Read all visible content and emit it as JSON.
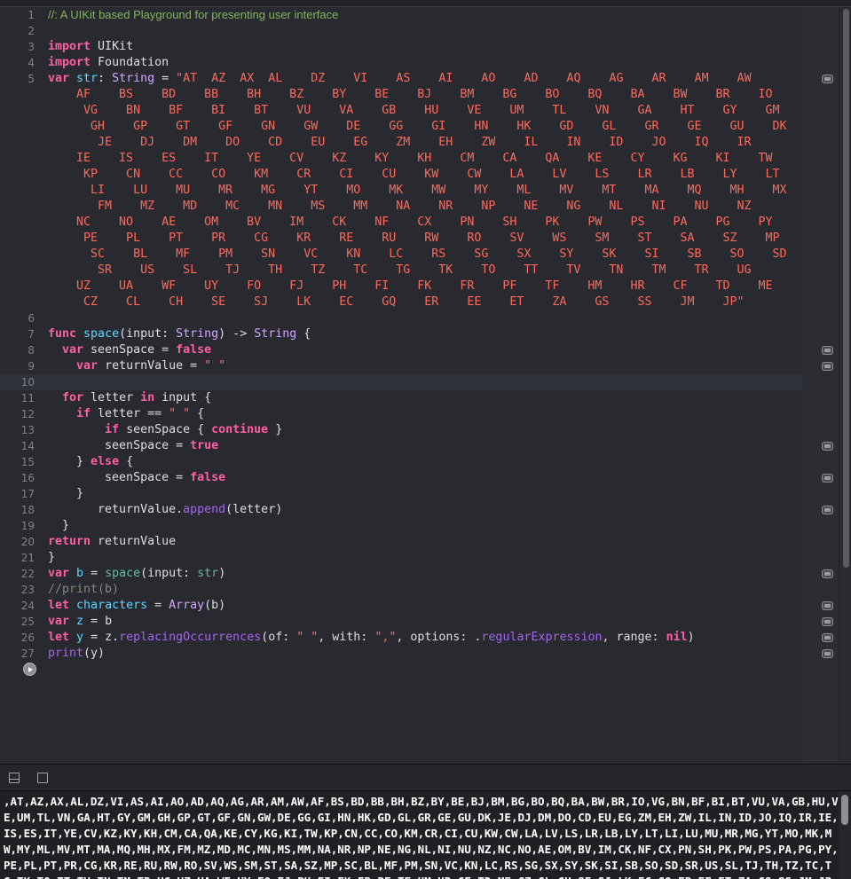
{
  "editor": {
    "current_line": 10,
    "result_lines": [
      5,
      8,
      9,
      14,
      16,
      18,
      22,
      24,
      25,
      26,
      27
    ],
    "lines": [
      {
        "n": 1,
        "tokens": [
          [
            "doc",
            "//: A UIKit based Playground for presenting user interface"
          ]
        ]
      },
      {
        "n": 2,
        "tokens": []
      },
      {
        "n": 3,
        "tokens": [
          [
            "k",
            "import"
          ],
          [
            "p",
            " UIKit"
          ]
        ]
      },
      {
        "n": 4,
        "tokens": [
          [
            "k",
            "import"
          ],
          [
            "p",
            " Foundation"
          ]
        ]
      },
      {
        "n": 5,
        "tokens": [
          [
            "k",
            "var"
          ],
          [
            "p",
            " "
          ],
          [
            "v",
            "str"
          ],
          [
            "p",
            ": "
          ],
          [
            "t",
            "String"
          ],
          [
            "p",
            " = "
          ],
          [
            "s",
            "\"AT  AZ  AX  AL    DZ    VI    AS    AI    AO    AD    AQ    AG    AR    AM    AW"
          ]
        ],
        "wrap": [
          "    AF    BS    BD    BB    BH    BZ    BY    BE    BJ    BM    BG    BO    BQ    BA    BW    BR    IO",
          "     VG    BN    BF    BI    BT    VU    VA    GB    HU    VE    UM    TL    VN    GA    HT    GY    GM",
          "      GH    GP    GT    GF    GN    GW    DE    GG    GI    HN    HK    GD    GL    GR    GE    GU    DK",
          "       JE    DJ    DM    DO    CD    EU    EG    ZM    EH    ZW    IL    IN    ID    JO    IQ    IR",
          "    IE    IS    ES    IT    YE    CV    KZ    KY    KH    CM    CA    QA    KE    CY    KG    KI    TW",
          "     KP    CN    CC    CO    KM    CR    CI    CU    KW    CW    LA    LV    LS    LR    LB    LY    LT",
          "      LI    LU    MU    MR    MG    YT    MO    MK    MW    MY    ML    MV    MT    MA    MQ    MH    MX",
          "       FM    MZ    MD    MC    MN    MS    MM    NA    NR    NP    NE    NG    NL    NI    NU    NZ",
          "    NC    NO    AE    OM    BV    IM    CK    NF    CX    PN    SH    PK    PW    PS    PA    PG    PY",
          "     PE    PL    PT    PR    CG    KR    RE    RU    RW    RO    SV    WS    SM    ST    SA    SZ    MP",
          "      SC    BL    MF    PM    SN    VC    KN    LC    RS    SG    SX    SY    SK    SI    SB    SO    SD",
          "       SR    US    SL    TJ    TH    TZ    TC    TG    TK    TO    TT    TV    TN    TM    TR    UG",
          "    UZ    UA    WF    UY    FO    FJ    PH    FI    FK    FR    PF    TF    HM    HR    CF    TD    ME",
          "     CZ    CL    CH    SE    SJ    LK    EC    GQ    ER    EE    ET    ZA    GS    SS    JM    JP\""
        ]
      },
      {
        "n": 6,
        "tokens": []
      },
      {
        "n": 7,
        "tokens": [
          [
            "k",
            "func"
          ],
          [
            "p",
            " "
          ],
          [
            "v",
            "space"
          ],
          [
            "p",
            "(input: "
          ],
          [
            "t",
            "String"
          ],
          [
            "p",
            ") -> "
          ],
          [
            "t",
            "String"
          ],
          [
            "p",
            " {"
          ]
        ]
      },
      {
        "n": 8,
        "tokens": [
          [
            "p",
            "  "
          ],
          [
            "k",
            "var"
          ],
          [
            "p",
            " seenSpace = "
          ],
          [
            "k",
            "false"
          ]
        ]
      },
      {
        "n": 9,
        "tokens": [
          [
            "p",
            "    "
          ],
          [
            "k",
            "var"
          ],
          [
            "p",
            " returnValue = "
          ],
          [
            "s",
            "\" \""
          ]
        ]
      },
      {
        "n": 10,
        "tokens": []
      },
      {
        "n": 11,
        "tokens": [
          [
            "p",
            "  "
          ],
          [
            "k",
            "for"
          ],
          [
            "p",
            " letter "
          ],
          [
            "k",
            "in"
          ],
          [
            "p",
            " input {"
          ]
        ]
      },
      {
        "n": 12,
        "tokens": [
          [
            "p",
            "    "
          ],
          [
            "k",
            "if"
          ],
          [
            "p",
            " letter == "
          ],
          [
            "s",
            "\" \""
          ],
          [
            "p",
            " {"
          ]
        ]
      },
      {
        "n": 13,
        "tokens": [
          [
            "p",
            "        "
          ],
          [
            "k",
            "if"
          ],
          [
            "p",
            " seenSpace { "
          ],
          [
            "k",
            "continue"
          ],
          [
            "p",
            " }"
          ]
        ]
      },
      {
        "n": 14,
        "tokens": [
          [
            "p",
            "        seenSpace = "
          ],
          [
            "k",
            "true"
          ]
        ]
      },
      {
        "n": 15,
        "tokens": [
          [
            "p",
            "    } "
          ],
          [
            "k",
            "else"
          ],
          [
            "p",
            " {"
          ]
        ]
      },
      {
        "n": 16,
        "tokens": [
          [
            "p",
            "        seenSpace = "
          ],
          [
            "k",
            "false"
          ]
        ]
      },
      {
        "n": 17,
        "tokens": [
          [
            "p",
            "    }"
          ]
        ]
      },
      {
        "n": 18,
        "tokens": [
          [
            "p",
            "       returnValue."
          ],
          [
            "f",
            "append"
          ],
          [
            "p",
            "(letter)"
          ]
        ]
      },
      {
        "n": 19,
        "tokens": [
          [
            "p",
            "  }"
          ]
        ]
      },
      {
        "n": 20,
        "tokens": [
          [
            "k",
            "return"
          ],
          [
            "p",
            " returnValue"
          ]
        ]
      },
      {
        "n": 21,
        "tokens": [
          [
            "p",
            "}"
          ]
        ]
      },
      {
        "n": 22,
        "tokens": [
          [
            "k",
            "var"
          ],
          [
            "p",
            " "
          ],
          [
            "v",
            "b"
          ],
          [
            "p",
            " = "
          ],
          [
            "u",
            "space"
          ],
          [
            "p",
            "(input: "
          ],
          [
            "u",
            "str"
          ],
          [
            "p",
            ")"
          ]
        ]
      },
      {
        "n": 23,
        "tokens": [
          [
            "c",
            "//print(b)"
          ]
        ]
      },
      {
        "n": 24,
        "tokens": [
          [
            "k",
            "let"
          ],
          [
            "p",
            " "
          ],
          [
            "v",
            "characters"
          ],
          [
            "p",
            " = "
          ],
          [
            "t",
            "Array"
          ],
          [
            "p",
            "(b)"
          ]
        ]
      },
      {
        "n": 25,
        "tokens": [
          [
            "k",
            "var"
          ],
          [
            "p",
            " "
          ],
          [
            "v",
            "z"
          ],
          [
            "p",
            " = b"
          ]
        ]
      },
      {
        "n": 26,
        "tokens": [
          [
            "k",
            "let"
          ],
          [
            "p",
            " "
          ],
          [
            "v",
            "y"
          ],
          [
            "p",
            " = z."
          ],
          [
            "f",
            "replacingOccurrences"
          ],
          [
            "p",
            "(of: "
          ],
          [
            "s",
            "\" \""
          ],
          [
            "p",
            ", with: "
          ],
          [
            "s",
            "\",\""
          ],
          [
            "p",
            ", options: ."
          ],
          [
            "f",
            "regularExpression"
          ],
          [
            "p",
            ", range: "
          ],
          [
            "k",
            "nil"
          ],
          [
            "p",
            ")"
          ]
        ]
      },
      {
        "n": 27,
        "tokens": [
          [
            "f",
            "print"
          ],
          [
            "p",
            "(y)"
          ]
        ]
      }
    ]
  },
  "console": {
    "output": ",AT,AZ,AX,AL,DZ,VI,AS,AI,AO,AD,AQ,AG,AR,AM,AW,AF,BS,BD,BB,BH,BZ,BY,BE,BJ,BM,BG,BO,BQ,BA,BW,BR,IO,VG,BN,BF,BI,BT,VU,VA,GB,HU,VE,UM,TL,VN,GA,HT,GY,GM,GH,GP,GT,GF,GN,GW,DE,GG,GI,HN,HK,GD,GL,GR,GE,GU,DK,JE,DJ,DM,DO,CD,EU,EG,ZM,EH,ZW,IL,IN,ID,JO,IQ,IR,IE,IS,ES,IT,YE,CV,KZ,KY,KH,CM,CA,QA,KE,CY,KG,KI,TW,KP,CN,CC,CO,KM,CR,CI,CU,KW,CW,LA,LV,LS,LR,LB,LY,LT,LI,LU,MU,MR,MG,YT,MO,MK,MW,MY,ML,MV,MT,MA,MQ,MH,MX,FM,MZ,MD,MC,MN,MS,MM,NA,NR,NP,NE,NG,NL,NI,NU,NZ,NC,NO,AE,OM,BV,IM,CK,NF,CX,PN,SH,PK,PW,PS,PA,PG,PY,PE,PL,PT,PR,CG,KR,RE,RU,RW,RO,SV,WS,SM,ST,SA,SZ,MP,SC,BL,MF,PM,SN,VC,KN,LC,RS,SG,SX,SY,SK,SI,SB,SO,SD,SR,US,SL,TJ,TH,TZ,TC,TG,TK,TO,TT,TV,TN,TM,TR,UG,UZ,UA,WF,UY,FO,FJ,PH,FI,FK,FR,PF,TF,HM,HR,CF,TD,ME,CZ,CL,CH,SE,SJ,LK,EC,GQ,ER,EE,ET,ZA,GS,SS,JM,JP"
  }
}
